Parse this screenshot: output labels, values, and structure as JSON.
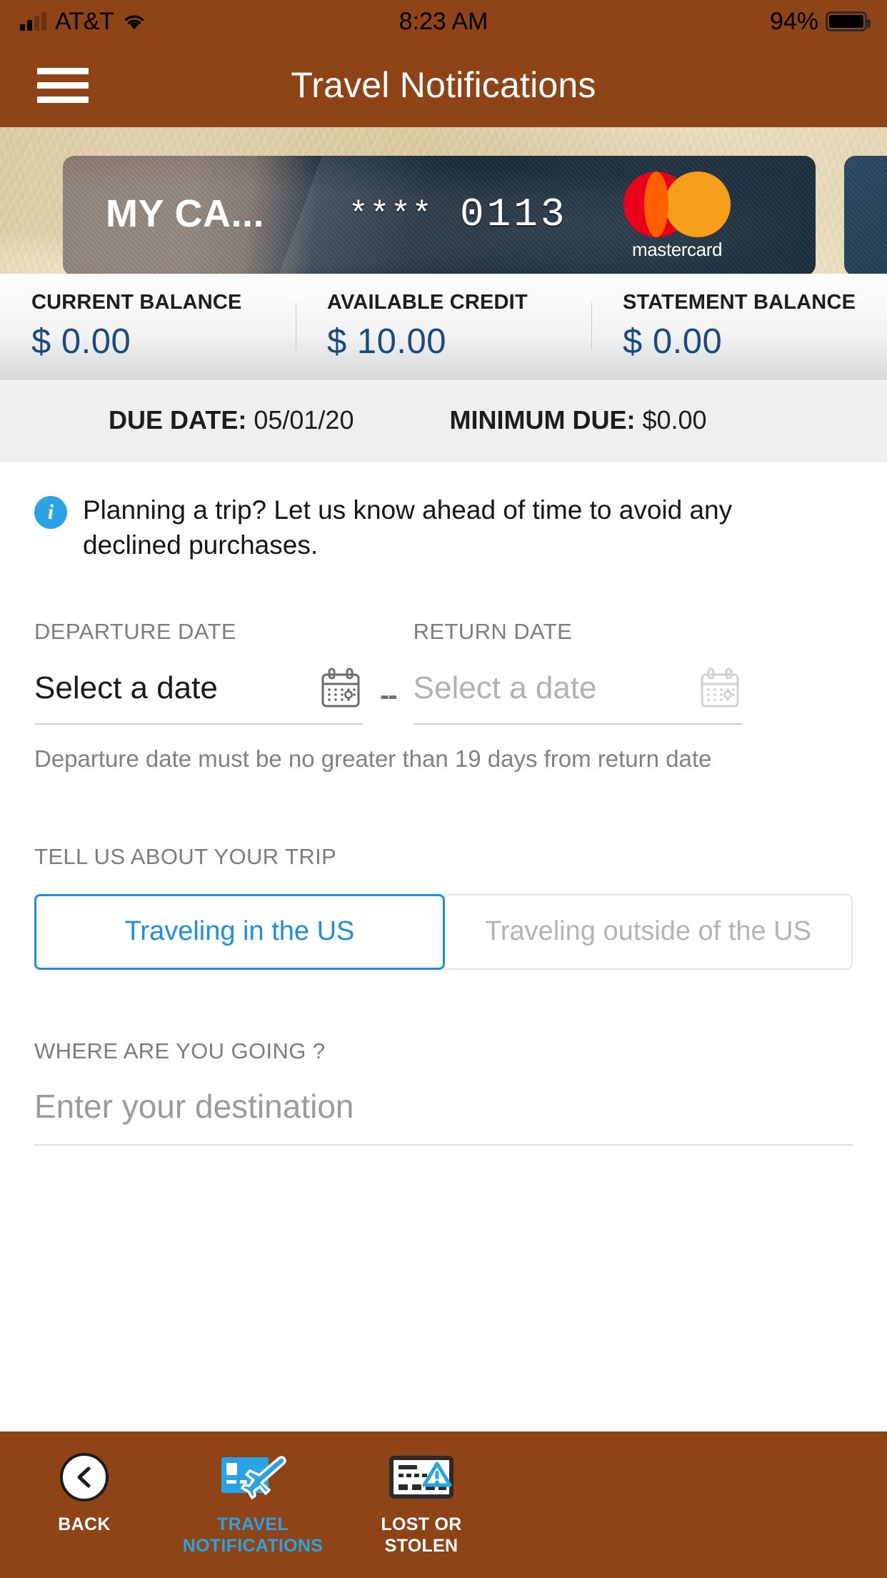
{
  "status_bar": {
    "carrier": "AT&T",
    "time": "8:23 AM",
    "battery_percent": "94%",
    "signal_icon": "cellular-signal-icon",
    "wifi_icon": "wifi-icon",
    "battery_icon": "battery-icon"
  },
  "header": {
    "title": "Travel Notifications",
    "menu_icon": "hamburger-menu-icon"
  },
  "card": {
    "nickname": "MY CA...",
    "masked_digits": "****",
    "last_four": "0113",
    "network": "mastercard",
    "network_wordmark": "mastercard"
  },
  "balances": [
    {
      "label": "CURRENT BALANCE",
      "value": "$ 0.00"
    },
    {
      "label": "AVAILABLE CREDIT",
      "value": "$ 10.00"
    },
    {
      "label": "STATEMENT BALANCE",
      "value": "$ 0.00"
    }
  ],
  "due": {
    "due_date_label": "DUE DATE:",
    "due_date_value": "05/01/20",
    "minimum_due_label": "MINIMUM DUE:",
    "minimum_due_value": "$0.00"
  },
  "info_banner": {
    "icon": "info-icon",
    "text": "Planning a trip? Let us know ahead of time to avoid any declined purchases."
  },
  "departure": {
    "label": "DEPARTURE DATE",
    "value": "Select a date",
    "calendar_icon": "calendar-icon"
  },
  "separator": "--",
  "return": {
    "label": "RETURN DATE",
    "placeholder": "Select a date",
    "calendar_icon": "calendar-icon"
  },
  "date_hint": "Departure date must be no greater than 19 days from return date",
  "trip": {
    "section_label": "TELL US ABOUT YOUR TRIP",
    "options": [
      {
        "label": "Traveling in the US",
        "selected": true
      },
      {
        "label": "Traveling outside of the US",
        "selected": false
      }
    ]
  },
  "destination": {
    "label": "WHERE ARE YOU GOING ?",
    "value": "",
    "placeholder": "Enter your destination"
  },
  "bottom_nav": [
    {
      "label": "BACK",
      "icon": "back-chevron-icon",
      "active": false
    },
    {
      "label": "TRAVEL NOTIFICATIONS",
      "label_line1": "TRAVEL",
      "label_line2": "NOTIFICATIONS",
      "icon": "card-airplane-icon",
      "active": true
    },
    {
      "label": "LOST OR STOLEN",
      "label_line1": "LOST OR",
      "label_line2": "STOLEN",
      "icon": "card-warning-icon",
      "active": false
    }
  ],
  "colors": {
    "brand_brown": "#8E4417",
    "accent_blue": "#29A3E3",
    "segment_blue": "#1E8FE0",
    "balance_navy": "#1b4a7f",
    "mastercard_red": "#EB001B",
    "mastercard_yellow": "#F79E1B",
    "mastercard_overlap": "#FF5F00"
  }
}
